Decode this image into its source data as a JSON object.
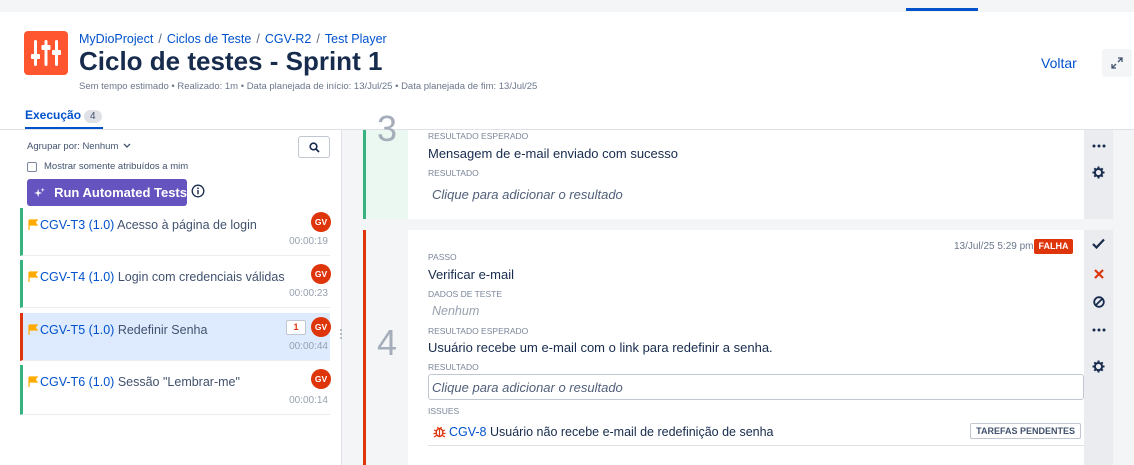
{
  "breadcrumb": {
    "project": "MyDioProject",
    "cycles": "Ciclos de Teste",
    "cycle_key": "CGV-R2",
    "player": "Test Player",
    "separator": "/"
  },
  "page": {
    "title": "Ciclo de testes - Sprint 1",
    "meta": "Sem tempo estimado • Realizado: 1m • Data planejada de início: 13/Jul/25 • Data planejada de fim: 13/Jul/25",
    "back_label": "Voltar"
  },
  "tabs": [
    {
      "label": "Execução",
      "count": "4"
    }
  ],
  "sidebar": {
    "group_by": "Agrupar por: Nenhum",
    "only_mine": "Mostrar somente atribuídos a mim",
    "run_button": "Run Automated Tests",
    "items": [
      {
        "key": "CGV-T3 (1.0)",
        "title": "Acesso à página de login",
        "avatar": "GV",
        "time": "00:00:19",
        "status": "pass"
      },
      {
        "key": "CGV-T4 (1.0)",
        "title": "Login com credenciais válidas",
        "avatar": "GV",
        "time": "00:00:23",
        "status": "pass"
      },
      {
        "key": "CGV-T5 (1.0)",
        "title": "Redefinir Senha",
        "avatar": "GV",
        "time": "00:00:44",
        "status": "fail",
        "issues": "1"
      },
      {
        "key": "CGV-T6 (1.0)",
        "title": "Sessão \"Lembrar-me\"",
        "avatar": "GV",
        "time": "00:00:14",
        "status": "pass"
      }
    ]
  },
  "steps": [
    {
      "number": "3",
      "expected_label": "Resultado esperado",
      "expected": "Mensagem de e-mail enviado com sucesso",
      "result_label": "Resultado",
      "result_placeholder": "Clique para adicionar o resultado"
    },
    {
      "number": "4",
      "date": "13/Jul/25 5:29 pm",
      "status": "FALHA",
      "step_label": "Passo",
      "step": "Verificar e-mail",
      "test_data_label": "Dados de teste",
      "test_data": "Nenhum",
      "expected_label": "Resultado esperado",
      "expected": "Usuário recebe um e-mail com o link para redefinir a senha.",
      "result_label": "Resultado",
      "result_placeholder": "Clique para adicionar o resultado",
      "issues_label": "Issues",
      "issue_key": "CGV-8",
      "issue_title": "Usuário não recebe e-mail de redefinição de senha",
      "issue_status": "TAREFAS PENDENTES"
    }
  ],
  "colors": {
    "pass": "#36b37e",
    "fail": "#de350b",
    "brand": "#ff5630",
    "accent": "#0052cc",
    "run_button": "#6554c0"
  }
}
